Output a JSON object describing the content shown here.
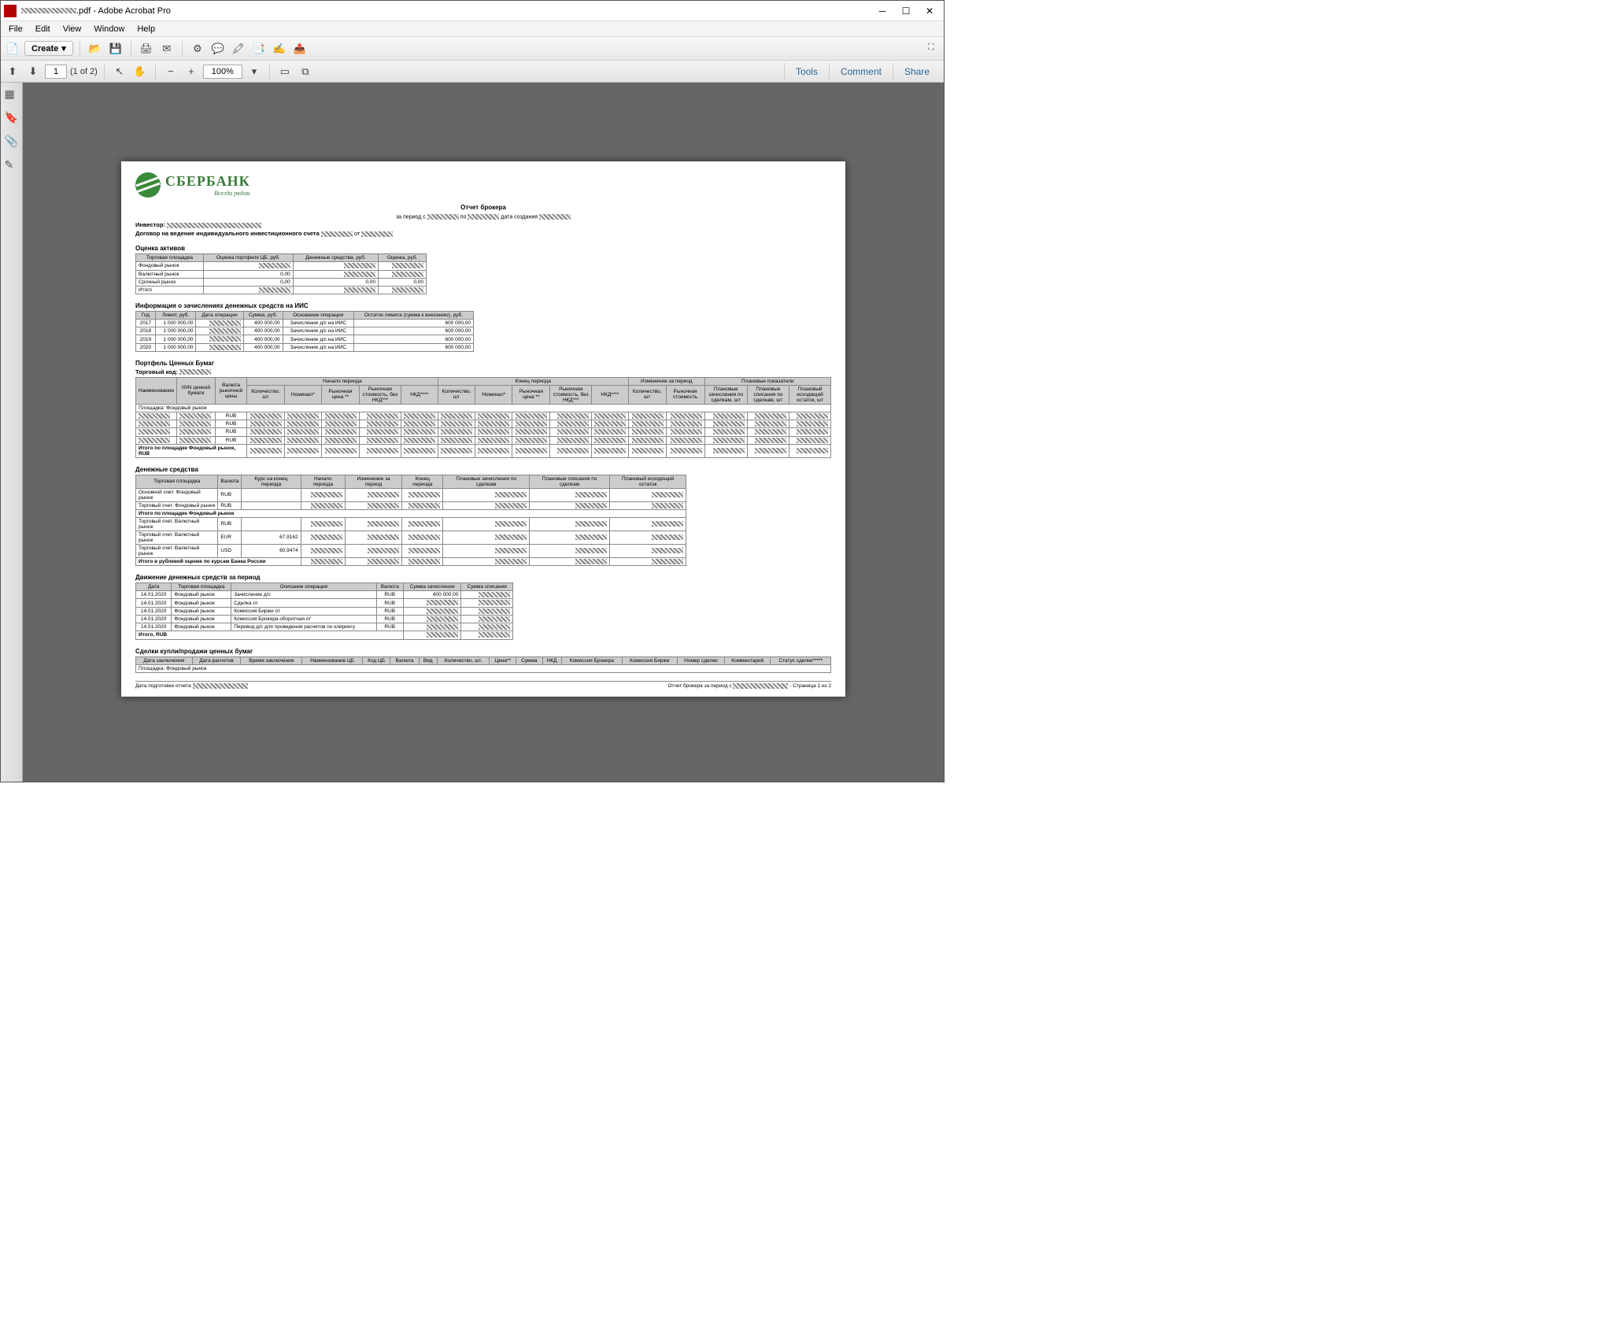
{
  "window": {
    "title": ".pdf - Adobe Acrobat Pro",
    "minimize": "─",
    "maximize": "☐",
    "close": "✕"
  },
  "menu": {
    "file": "File",
    "edit": "Edit",
    "view": "View",
    "window": "Window",
    "help": "Help"
  },
  "toolbar": {
    "create": "Create",
    "page_num": "1",
    "page_of": "(1 of 2)",
    "zoom": "100%",
    "tools": "Tools",
    "comment": "Comment",
    "share": "Share"
  },
  "doc": {
    "logo_name": "СБЕРБАНК",
    "logo_tag": "Всегда рядом",
    "report_title": "Отчет брокера",
    "report_sub_prefix": "за период с",
    "report_sub_mid": "по",
    "report_sub_date": "дата создания",
    "investor_label": "Инвестор:",
    "contract_text": "Договор на ведение индивидуального инвестиционного счета",
    "contract_from": "от",
    "s_assets": "Оценка активов",
    "assets_headers": [
      "Торговая площадка",
      "Оценка портфеля ЦБ, руб.",
      "Денежные средства, руб.",
      "Оценка, руб."
    ],
    "assets_rows": [
      [
        "Фондовый рынок",
        "",
        "",
        ""
      ],
      [
        "Валютный рынок",
        "0,00",
        "",
        ""
      ],
      [
        "Срочный рынок",
        "0,00",
        "0,00",
        "0,00"
      ],
      [
        "Итого",
        "",
        "",
        ""
      ]
    ],
    "s_deposits": "Информация о зачислениях денежных средств на ИИС",
    "dep_headers": [
      "Год",
      "Лимит, руб.",
      "Дата операции",
      "Сумма, руб.",
      "Основание операции",
      "Остаток лимита (сумма к внесению), руб."
    ],
    "dep_rows": [
      [
        "2017",
        "1 000 000,00",
        "",
        "400 000,00",
        "Зачисление д/с на ИИС",
        "600 000,00"
      ],
      [
        "2018",
        "1 000 000,00",
        "",
        "400 000,00",
        "Зачисление д/с на ИИС",
        "600 000,00"
      ],
      [
        "2019",
        "1 000 000,00",
        "",
        "400 000,00",
        "Зачисление д/с на ИИС",
        "600 000,00"
      ],
      [
        "2020",
        "1 000 000,00",
        "",
        "400 000,00",
        "Зачисление д/с на ИИС",
        "600 000,00"
      ]
    ],
    "s_portfolio": "Портфель Ценных Бумаг",
    "trade_code": "Торговый код:",
    "pf_group": [
      "Начало периода",
      "Конец периода",
      "Изменение за период",
      "Плановые показатели"
    ],
    "pf_headers": [
      "Наименование",
      "ISIN ценной бумаги",
      "Валюта рыночной цены",
      "Количество, шт",
      "Номинал*",
      "Рыночная цена **",
      "Рыночная стоимость, без НКД***",
      "НКД****",
      "Количество, шт",
      "Номинал*",
      "Рыночная цена **",
      "Рыночная стоимость, без НКД***",
      "НКД****",
      "Количество, шт",
      "Рыночная стоимость",
      "Плановые зачисления по сделкам, шт",
      "Плановые списания по сделкам, шт",
      "Плановый исходящий остаток, шт"
    ],
    "pf_area": "Площадка: Фондовый рынок",
    "pf_currency_rows": [
      "RUB",
      "RUB",
      "RUB",
      "RUB"
    ],
    "pf_total": "Итого по площадке Фондовый рынок, RUB",
    "s_cash": "Денежные средства",
    "cash_headers": [
      "Торговая площадка",
      "Валюта",
      "Курс на конец периода",
      "Начало периода",
      "Изменение за период",
      "Конец периода",
      "Плановые зачисления по сделкам",
      "Плановые списания по сделкам",
      "Плановый исходящий остаток"
    ],
    "cash_rows": [
      [
        "Основной счет. Фондовый рынок",
        "RUB",
        "",
        "",
        "",
        "",
        "",
        "",
        ""
      ],
      [
        "Торговый счет. Фондовый рынок",
        "RUB",
        "",
        "",
        "",
        "",
        "",
        "",
        ""
      ]
    ],
    "cash_subtotal1": "Итого по площадке Фондовый рынок",
    "cash_rows2": [
      [
        "Торговый счет. Валютный рынок",
        "RUB",
        "",
        "",
        "",
        "",
        "",
        "",
        ""
      ],
      [
        "Торговый счет. Валютный рынок",
        "EUR",
        "67,9162",
        "",
        "",
        "",
        "",
        "",
        ""
      ],
      [
        "Торговый счет. Валютный рынок",
        "USD",
        "60,9474",
        "",
        "",
        "",
        "",
        "",
        ""
      ]
    ],
    "cash_total": "Итого в рублевой оценке по курсам Банка России",
    "s_moves": "Движение денежных средств за период",
    "mv_headers": [
      "Дата",
      "Торговая площадка",
      "Описание операции",
      "Валюта",
      "Сумма зачисления",
      "Сумма списания"
    ],
    "mv_rows": [
      [
        "14.01.2020",
        "Фондовый рынок",
        "Зачисление д/с",
        "RUB",
        "400 000,00",
        ""
      ],
      [
        "14.01.2020",
        "Фондовый рынок",
        "Сделка от",
        "RUB",
        "",
        ""
      ],
      [
        "14.01.2020",
        "Фондовый рынок",
        "Комиссия Биржи от",
        "RUB",
        "",
        ""
      ],
      [
        "14.01.2020",
        "Фондовый рынок",
        "Комиссия Брокера оборотная от",
        "RUB",
        "",
        ""
      ],
      [
        "14.01.2020",
        "Фондовый рынок",
        "Перевод д/с для проведения расчетов по клирингу",
        "RUB",
        "",
        ""
      ]
    ],
    "mv_total": "Итого, RUB",
    "s_deals": "Сделки купли/продажи ценных бумаг",
    "deals_headers": [
      "Дата заключения",
      "Дата расчетов",
      "Время заключения",
      "Наименование ЦБ",
      "Код ЦБ",
      "Валюта",
      "Вид",
      "Количество, шт.",
      "Цена**",
      "Сумма",
      "НКД",
      "Комиссия Брокера",
      "Комиссия Биржи",
      "Номер сделки",
      "Комментарий",
      "Статус сделки*****"
    ],
    "deals_area": "Площадка: Фондовый рынок",
    "footer_left": "Дата подготовки отчета",
    "footer_right_prefix": "Отчет брокера за период с",
    "footer_page": "- Страница 1 из 2"
  }
}
